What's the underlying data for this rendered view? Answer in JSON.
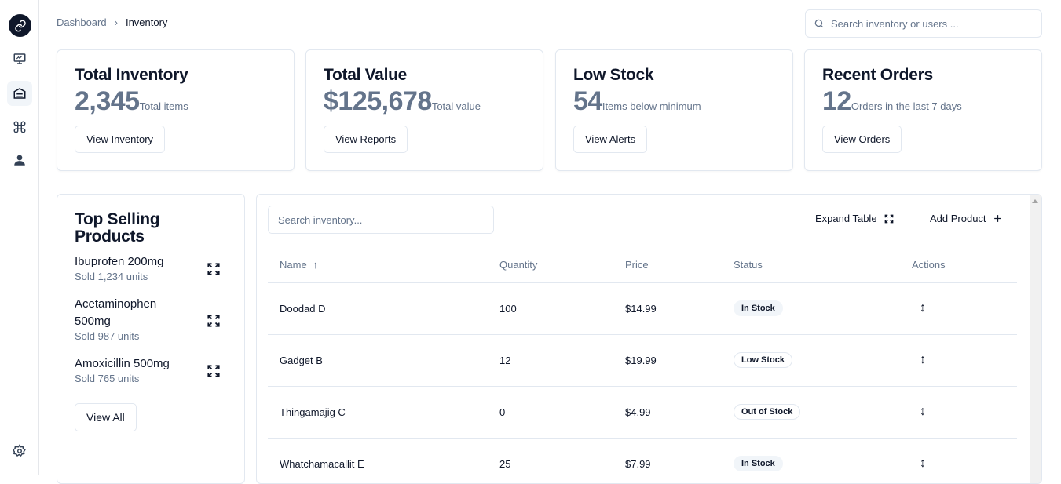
{
  "breadcrumb": {
    "root": "Dashboard",
    "separator": "›",
    "current": "Inventory"
  },
  "top_search": {
    "placeholder": "Search inventory or users ..."
  },
  "sidebar": {
    "items": [
      {
        "icon": "link-icon",
        "label": ""
      },
      {
        "icon": "monitor-icon",
        "label": ""
      },
      {
        "icon": "warehouse-icon",
        "label": "",
        "active": true
      },
      {
        "icon": "command-icon",
        "label": ""
      },
      {
        "icon": "user-icon",
        "label": ""
      }
    ],
    "settings_icon": "gear-icon"
  },
  "stats": [
    {
      "title": "Total Inventory",
      "value": "2,345",
      "sub": "Total items",
      "button": "View Inventory"
    },
    {
      "title": "Total Value",
      "value": "$125,678",
      "sub": "Total value",
      "button": "View Reports"
    },
    {
      "title": "Low Stock",
      "value": "54",
      "sub": "Items below minimum",
      "button": "View Alerts"
    },
    {
      "title": "Recent Orders",
      "value": "12",
      "sub": "Orders in the last 7 days",
      "button": "View Orders"
    }
  ],
  "top_selling": {
    "title": "Top Selling Products",
    "products": [
      {
        "name": "Ibuprofen 200mg",
        "sold": "Sold 1,234 units"
      },
      {
        "name": "Acetaminophen 500mg",
        "sold": "Sold 987 units"
      },
      {
        "name": "Amoxicillin 500mg",
        "sold": "Sold 765 units"
      }
    ],
    "view_all": "View All"
  },
  "table": {
    "search_placeholder": "Search inventory...",
    "expand_label": "Expand Table",
    "add_label": "Add Product",
    "columns": [
      "Name",
      "Quantity",
      "Price",
      "Status",
      "Actions"
    ],
    "rows": [
      {
        "name": "Doodad D",
        "quantity": "100",
        "price": "$14.99",
        "status": "In Stock"
      },
      {
        "name": "Gadget B",
        "quantity": "12",
        "price": "$19.99",
        "status": "Low Stock"
      },
      {
        "name": "Thingamajig C",
        "quantity": "0",
        "price": "$4.99",
        "status": "Out of Stock"
      },
      {
        "name": "Whatchamacallit E",
        "quantity": "25",
        "price": "$7.99",
        "status": "In Stock"
      }
    ]
  }
}
